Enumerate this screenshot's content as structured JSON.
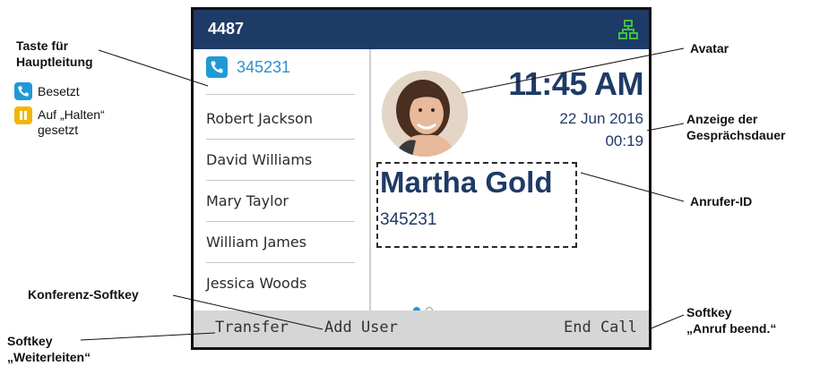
{
  "screen": {
    "extension": "4487",
    "line_key_number": "345231",
    "contacts": [
      "Robert Jackson",
      "David Williams",
      "Mary Taylor",
      "William James",
      "Jessica Woods"
    ],
    "time": "11:45 AM",
    "date": "22 Jun 2016",
    "call_duration": "00:19",
    "caller_name": "Martha Gold",
    "caller_number": "345231",
    "page_indicator": {
      "current": 1,
      "total": 2
    },
    "softkeys": {
      "transfer": "Transfer",
      "add_user": "Add User",
      "end_call": "End Call"
    }
  },
  "annotations": {
    "main_line_key": "Taste für\nHauptleitung",
    "legend_busy": "Besetzt",
    "legend_hold": "Auf „Halten“\ngesetzt",
    "avatar": "Avatar",
    "duration": "Anzeige der\nGesprächsdauer",
    "caller_id": "Anrufer-ID",
    "conference_softkey": "Konferenz-Softkey",
    "end_call_softkey": "Softkey\n„Anruf beend.“",
    "transfer_softkey": "Softkey\n„Weiterleiten“"
  },
  "colors": {
    "header_bg": "#1e3a66",
    "accent_blue": "#1f9ad6",
    "hold_yellow": "#f2b705",
    "softkey_bar": "#d6d6d6"
  },
  "icons": {
    "network": "network-icon",
    "phone": "phone-icon",
    "hold": "hold-icon"
  }
}
